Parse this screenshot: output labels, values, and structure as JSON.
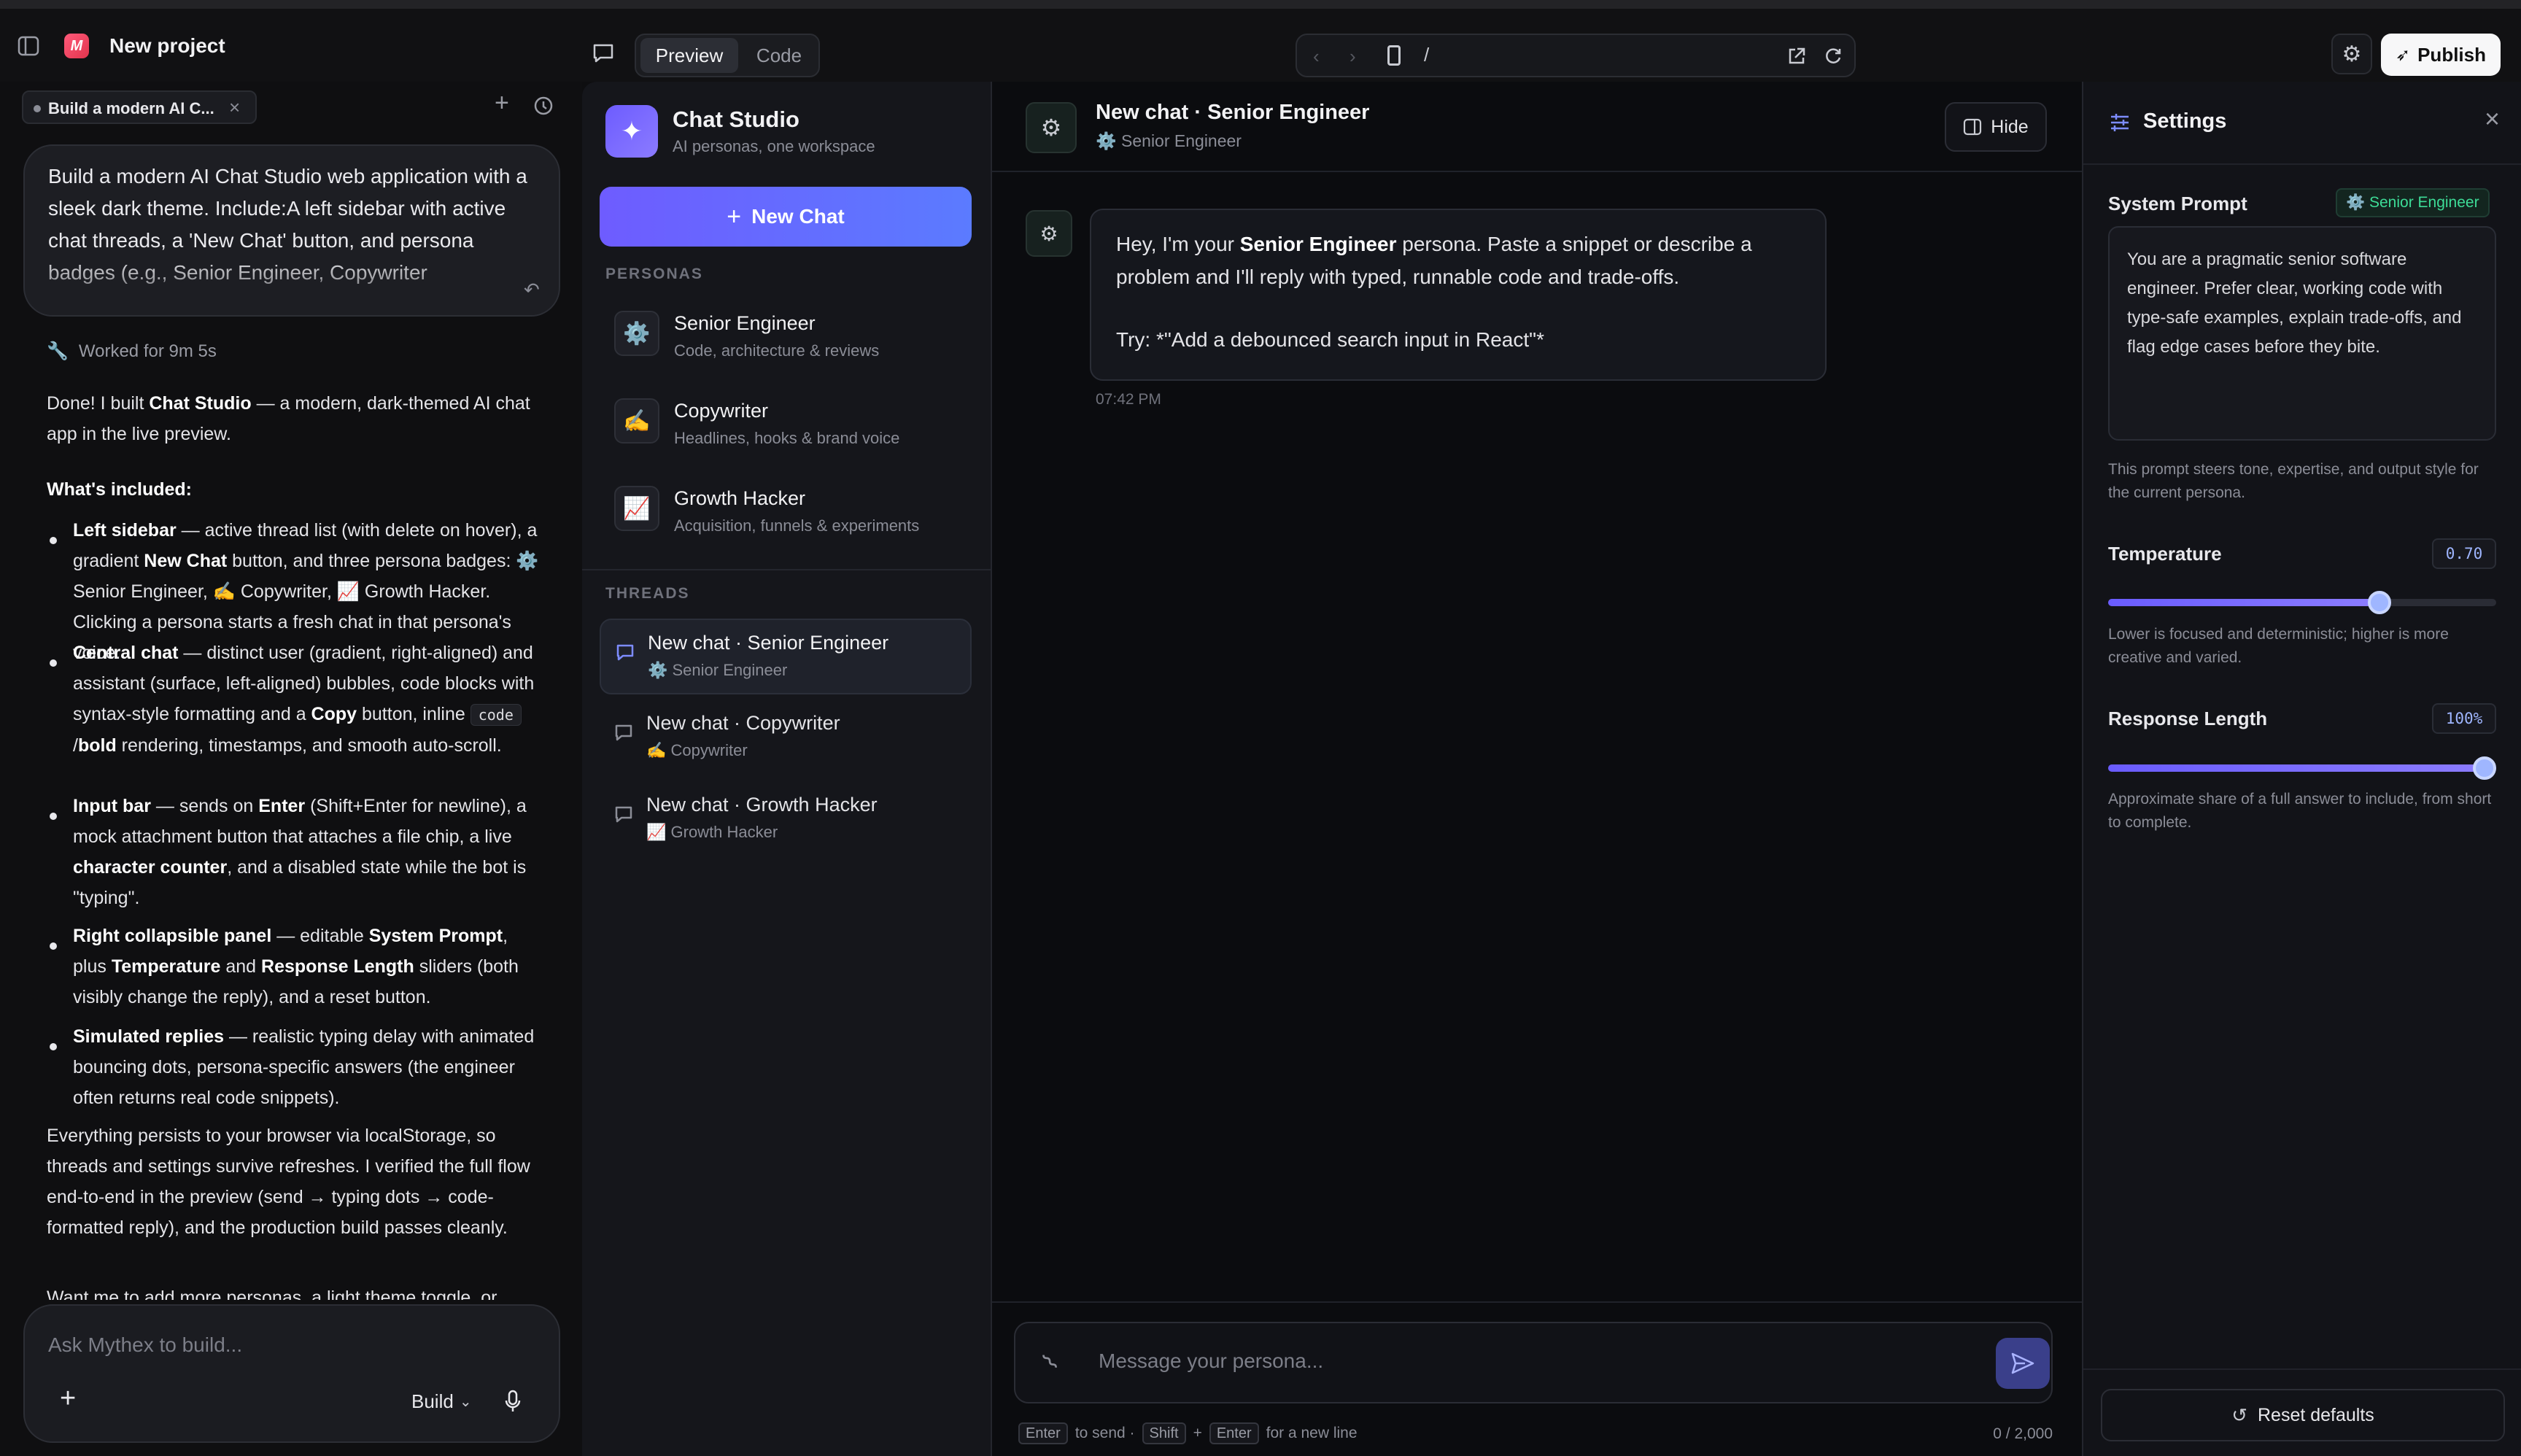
{
  "topbar": {
    "project_title": "New project",
    "tab_preview": "Preview",
    "tab_code": "Code",
    "url_path": "/",
    "publish_label": "Publish"
  },
  "left_panel": {
    "task_chip": "Build a modern AI C...",
    "prompt_text": "Build a modern AI Chat Studio web application with a sleek dark theme. Include:A left sidebar with active chat threads, a 'New Chat' button, and persona badges (e.g., Senior Engineer, Copywriter",
    "worked_for": "Worked for 9m 5s",
    "intro_before": "Done! I built ",
    "intro_bold": "Chat Studio",
    "intro_after": " — a modern, dark-themed AI chat app in the live preview.",
    "included_heading": "What's included:",
    "b1_bold": "Left sidebar",
    "b1_text_a": " — active thread list (with delete on hover), a gradient ",
    "b1_bold2": "New Chat",
    "b1_text_b": " button, and three persona badges: ⚙️ Senior Engineer, ✍️ Copywriter, 📈 Growth Hacker. Clicking a persona starts a fresh chat in that persona's voice.",
    "b2_bold": "Central chat",
    "b2_text_a": " — distinct user (gradient, right-aligned) and assistant (surface, left-aligned) bubbles, code blocks with syntax-style formatting and a ",
    "b2_bold2": "Copy",
    "b2_text_b": " button, inline ",
    "b2_code": "code",
    "b2_text_c": " /",
    "b2_bold3": "bold",
    "b2_text_d": " rendering, timestamps, and smooth auto-scroll.",
    "b3_bold": "Input bar",
    "b3_text_a": " — sends on ",
    "b3_bold2": "Enter",
    "b3_text_b": " (Shift+Enter for newline), a mock attachment button that attaches a file chip, a live ",
    "b3_bold3": "character counter",
    "b3_text_c": ", and a disabled state while the bot is \"typing\".",
    "b4_bold": "Right collapsible panel",
    "b4_text_a": " — editable ",
    "b4_bold2": "System Prompt",
    "b4_text_b": ", plus ",
    "b4_bold3": "Temperature",
    "b4_text_c": " and ",
    "b4_bold4": "Response Length",
    "b4_text_d": " sliders (both visibly change the reply), and a reset button.",
    "b5_bold": "Simulated replies",
    "b5_text": " — realistic typing delay with animated bouncing dots, persona-specific answers (the engineer often returns real code snippets).",
    "outro": "Everything persists to your browser via localStorage, so threads and settings survive refreshes. I verified the full flow end-to-end in the preview (send → typing dots → code-formatted reply), and the production build passes cleanly.",
    "cutoff": "Want me to add more personas, a light theme toggle, or",
    "input_placeholder": "Ask Mythex to build...",
    "mode_label": "Build"
  },
  "sidebar": {
    "app_name": "Chat Studio",
    "app_tagline": "AI personas, one workspace",
    "new_chat_label": "New Chat",
    "personas_heading": "PERSONAS",
    "personas": [
      {
        "icon": "⚙️",
        "name": "Senior Engineer",
        "desc": "Code, architecture & reviews"
      },
      {
        "icon": "✍️",
        "name": "Copywriter",
        "desc": "Headlines, hooks & brand voice"
      },
      {
        "icon": "📈",
        "name": "Growth Hacker",
        "desc": "Acquisition, funnels & experiments"
      }
    ],
    "threads_heading": "THREADS",
    "threads": [
      {
        "title": "New chat · Senior Engineer",
        "persona": "⚙️ Senior Engineer"
      },
      {
        "title": "New chat · Copywriter",
        "persona": "✍️ Copywriter"
      },
      {
        "title": "New chat · Growth Hacker",
        "persona": "📈 Growth Hacker"
      }
    ]
  },
  "chat": {
    "title": "New chat · Senior Engineer",
    "subtitle": "⚙️ Senior Engineer",
    "hide_label": "Hide",
    "message_a": "Hey, I'm your ",
    "message_bold": "Senior Engineer",
    "message_b": " persona. Paste a snippet or describe a problem and I'll reply with typed, runnable code and trade-offs.",
    "message_try": "Try: *\"Add a debounced search input in React\"*",
    "timestamp": "07:42 PM",
    "input_placeholder": "Message your persona...",
    "hint_enter": "Enter",
    "hint_to_send": "to send ·",
    "hint_shift": "Shift",
    "hint_plus": "+",
    "hint_enter2": "Enter",
    "hint_newline": "for a new line",
    "char_count": "0 / 2,000"
  },
  "settings": {
    "title": "Settings",
    "system_prompt_label": "System Prompt",
    "persona_badge": "⚙️ Senior Engineer",
    "system_prompt_value": "You are a pragmatic senior software engineer. Prefer clear, working code with type-safe examples, explain trade-offs, and flag edge cases before they bite.",
    "system_prompt_help": "This prompt steers tone, expertise, and output style for the current persona.",
    "temperature_label": "Temperature",
    "temperature_value": "0.70",
    "temperature_fraction": 0.7,
    "temperature_help": "Lower is focused and deterministic; higher is more creative and varied.",
    "length_label": "Response Length",
    "length_value": "100%",
    "length_fraction": 1.0,
    "length_help": "Approximate share of a full answer to include, from short to complete.",
    "reset_label": "Reset defaults"
  },
  "colors": {
    "accent": "#6a5cff",
    "badge_green": "#3ddc97"
  }
}
